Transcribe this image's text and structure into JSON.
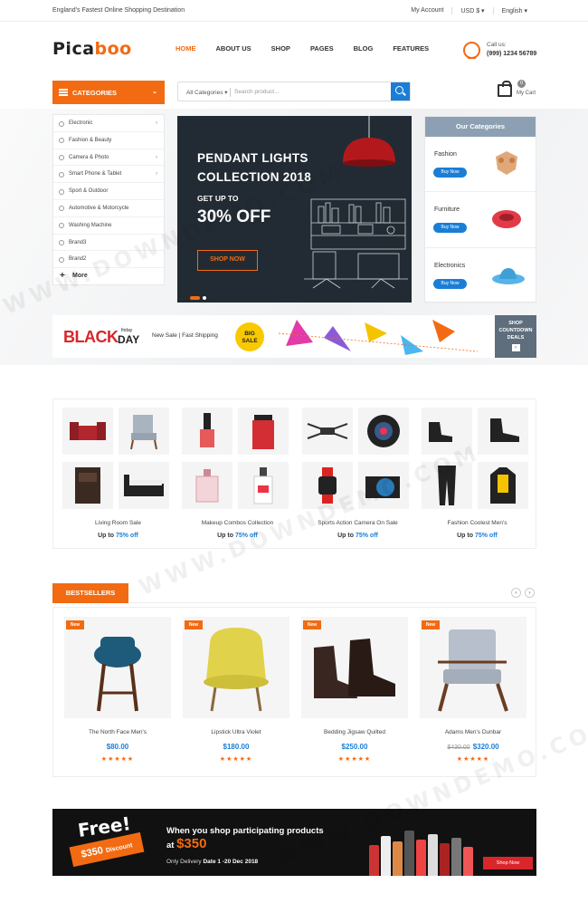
{
  "topbar": {
    "tagline": "England's Fastest Online Shopping Destination",
    "account": "My Account",
    "currency": "USD $",
    "language": "English"
  },
  "logo": {
    "part1": "Pica",
    "part2": "boo"
  },
  "nav": [
    "HOME",
    "ABOUT US",
    "SHOP",
    "PAGES",
    "BLOG",
    "FEATURES"
  ],
  "call": {
    "label": "Call us:",
    "phone": "(999) 1234 56789"
  },
  "categories_btn": "CATEGORIES",
  "search": {
    "category": "All Categories",
    "placeholder": "Search product..."
  },
  "cart": {
    "count": "0",
    "label": "My Cart"
  },
  "menu": [
    {
      "label": "Electronic",
      "arrow": true
    },
    {
      "label": "Fashion & Beauty",
      "arrow": false
    },
    {
      "label": "Camera & Photo",
      "arrow": true
    },
    {
      "label": "Smart Phone & Tablet",
      "arrow": true
    },
    {
      "label": "Sport & Outdoor",
      "arrow": false
    },
    {
      "label": "Automotive & Motorcycle",
      "arrow": false
    },
    {
      "label": "Washing Machine",
      "arrow": false
    },
    {
      "label": "Brand3",
      "arrow": false
    },
    {
      "label": "Brand2",
      "arrow": false
    }
  ],
  "more": "More",
  "hero": {
    "line1": "PENDANT LIGHTS",
    "line2": "COLLECTION 2018",
    "line3": "GET UP TO",
    "line4": "30% OFF",
    "button": "SHOP NOW"
  },
  "our_categories": {
    "title": "Our Categories",
    "items": [
      {
        "name": "Fashion",
        "button": "Buy Now"
      },
      {
        "name": "Furniture",
        "button": "Buy Now"
      },
      {
        "name": "Electronics",
        "button": "Buy Now"
      }
    ]
  },
  "blackday": {
    "black": "BLACK",
    "friday": "friday",
    "day": "DAY",
    "sale": "New Sale | Fast Shipping",
    "big": "BIG",
    "bigsale": "SALE",
    "side1": "SHOP",
    "side2": "COUNTDOWN",
    "side3": "DEALS"
  },
  "combos": [
    {
      "caption": "Living Room Sale",
      "prefix": "Up to",
      "percent": "75% off"
    },
    {
      "caption": "Makeup Combos Collection",
      "prefix": "Up to",
      "percent": "75% off"
    },
    {
      "caption": "Sports Action Camera On Sale",
      "prefix": "Up to",
      "percent": "75% off"
    },
    {
      "caption": "Fashion Coolest Men's",
      "prefix": "Up to",
      "percent": "75% off"
    }
  ],
  "bestsellers": {
    "title": "BESTSELLERS",
    "prev": "‹",
    "next": "›"
  },
  "products": [
    {
      "badge": "New",
      "name": "The North Face Men's",
      "old": "",
      "price": "$80.00",
      "stars": "★★★★★"
    },
    {
      "badge": "New",
      "name": "Lipstick Ultra Violet",
      "old": "",
      "price": "$180.00",
      "stars": "★★★★★"
    },
    {
      "badge": "New",
      "name": "Bedding Jigsaw Quilted",
      "old": "",
      "price": "$250.00",
      "stars": "★★★★★"
    },
    {
      "badge": "New",
      "name": "Adams Men's Dunbar",
      "old": "$430.00",
      "price": "$320.00",
      "stars": "★★★★★"
    }
  ],
  "promo": {
    "free": "Free!",
    "amount": "$350",
    "discount": "Discount",
    "line1": "When you shop participating products",
    "at": "at",
    "price": "$350",
    "line3a": "Only Delivery",
    "line3b": "Date 1 -20 Dec 2018",
    "button": "Shop Now"
  },
  "colors": {
    "accent": "#f26b12",
    "blue": "#1a7ed6",
    "dark": "#222b33",
    "gray": "#8da0b3"
  },
  "watermark": "WWW.DOWNDEMO.COM"
}
